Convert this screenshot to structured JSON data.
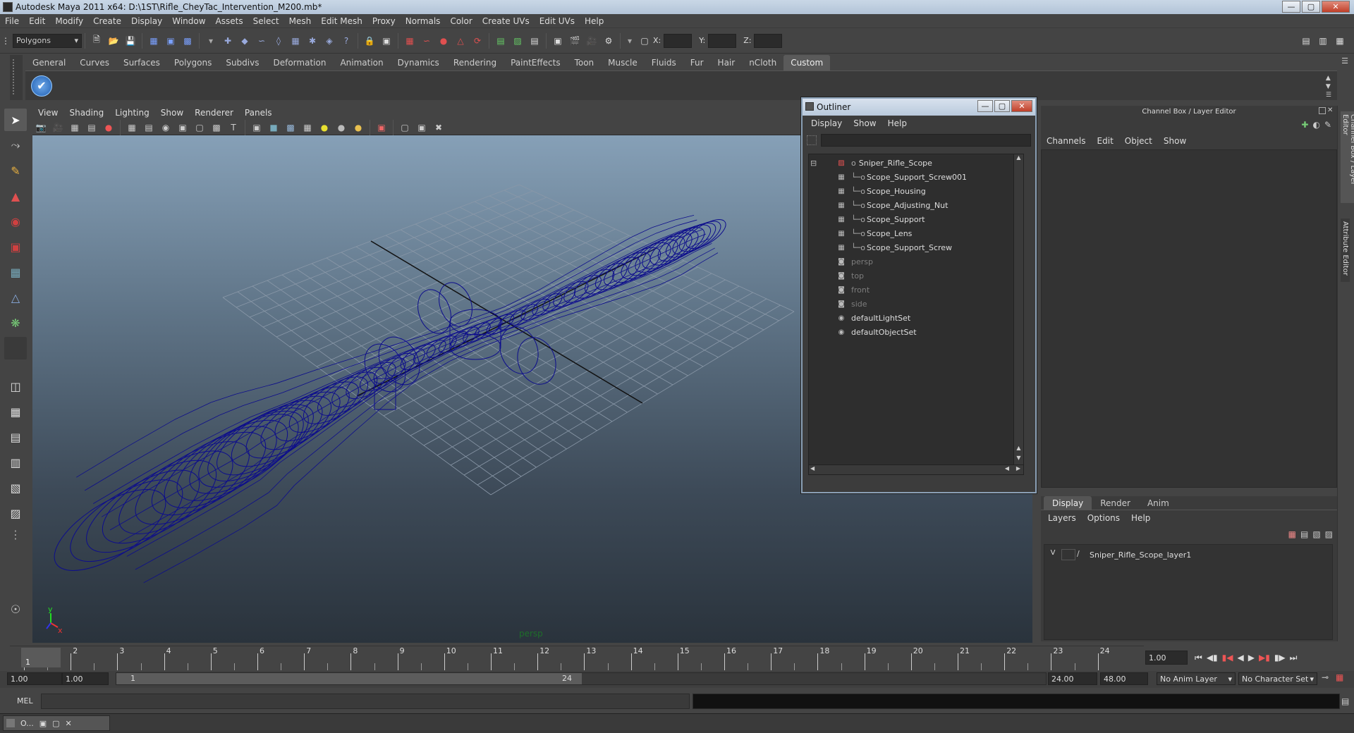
{
  "window": {
    "title": "Autodesk Maya 2011 x64: D:\\1ST\\Rifle_CheyTac_Intervention_M200.mb*"
  },
  "menu": [
    "File",
    "Edit",
    "Modify",
    "Create",
    "Display",
    "Window",
    "Assets",
    "Select",
    "Mesh",
    "Edit Mesh",
    "Proxy",
    "Normals",
    "Color",
    "Create UVs",
    "Edit UVs",
    "Help"
  ],
  "status": {
    "mode": "Polygons",
    "x_label": "X:",
    "y_label": "Y:",
    "z_label": "Z:"
  },
  "shelf_tabs": [
    "General",
    "Curves",
    "Surfaces",
    "Polygons",
    "Subdivs",
    "Deformation",
    "Animation",
    "Dynamics",
    "Rendering",
    "PaintEffects",
    "Toon",
    "Muscle",
    "Fluids",
    "Fur",
    "Hair",
    "nCloth",
    "Custom"
  ],
  "shelf_active": "Custom",
  "viewport": {
    "menu": [
      "View",
      "Shading",
      "Lighting",
      "Show",
      "Renderer",
      "Panels"
    ],
    "camera": "persp",
    "axis_x": "x",
    "axis_y": "y"
  },
  "outliner": {
    "title": "Outliner",
    "menu": [
      "Display",
      "Show",
      "Help"
    ],
    "items": [
      {
        "label": "Sniper_Rifle_Scope",
        "depth": 0,
        "dim": false,
        "icon": "group-icon"
      },
      {
        "label": "Scope_Support_Screw001",
        "depth": 1,
        "dim": false,
        "icon": "mesh-icon"
      },
      {
        "label": "Scope_Housing",
        "depth": 1,
        "dim": false,
        "icon": "mesh-icon"
      },
      {
        "label": "Scope_Adjusting_Nut",
        "depth": 1,
        "dim": false,
        "icon": "mesh-icon"
      },
      {
        "label": "Scope_Support",
        "depth": 1,
        "dim": false,
        "icon": "mesh-icon"
      },
      {
        "label": "Scope_Lens",
        "depth": 1,
        "dim": false,
        "icon": "mesh-icon"
      },
      {
        "label": "Scope_Support_Screw",
        "depth": 1,
        "dim": false,
        "icon": "mesh-icon"
      },
      {
        "label": "persp",
        "depth": 0,
        "dim": true,
        "icon": "camera-icon"
      },
      {
        "label": "top",
        "depth": 0,
        "dim": true,
        "icon": "camera-icon"
      },
      {
        "label": "front",
        "depth": 0,
        "dim": true,
        "icon": "camera-icon"
      },
      {
        "label": "side",
        "depth": 0,
        "dim": true,
        "icon": "camera-icon"
      },
      {
        "label": "defaultLightSet",
        "depth": 0,
        "dim": false,
        "icon": "set-icon"
      },
      {
        "label": "defaultObjectSet",
        "depth": 0,
        "dim": false,
        "icon": "set-icon"
      }
    ]
  },
  "channel_box": {
    "title": "Channel Box / Layer Editor",
    "menu": [
      "Channels",
      "Edit",
      "Object",
      "Show"
    ]
  },
  "side_tabs": [
    "Channel Box / Layer Editor",
    "Attribute Editor"
  ],
  "layer_editor": {
    "tabs": [
      "Display",
      "Render",
      "Anim"
    ],
    "active_tab": "Display",
    "menu": [
      "Layers",
      "Options",
      "Help"
    ],
    "layers": [
      {
        "visible": "V",
        "name": "Sniper_Rifle_Scope_layer1"
      }
    ]
  },
  "timeline": {
    "ticks": [
      "1",
      "2",
      "3",
      "4",
      "5",
      "6",
      "7",
      "8",
      "9",
      "10",
      "11",
      "12",
      "13",
      "14",
      "15",
      "16",
      "17",
      "18",
      "19",
      "20",
      "21",
      "22",
      "23",
      "24"
    ],
    "current": "1",
    "current_field": "1.00"
  },
  "range": {
    "start": "1.00",
    "start2": "1.00",
    "slider_start": "1",
    "slider_end": "24",
    "end": "24.00",
    "end2": "48.00",
    "anim_layer": "No Anim Layer",
    "char_set": "No Character Set"
  },
  "cmd": {
    "label": "MEL"
  },
  "taskbar": {
    "item": "O..."
  },
  "colors": {
    "wire": "#0d0d8c",
    "grid": "#8a98a8"
  }
}
